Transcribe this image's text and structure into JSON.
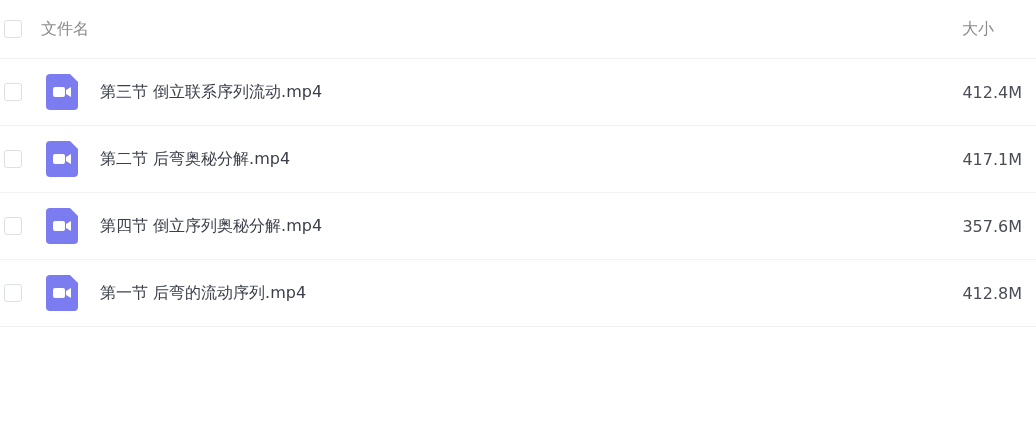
{
  "header": {
    "checked": false,
    "columns": [
      "文件名",
      "大小"
    ]
  },
  "rows": [
    {
      "checked": false,
      "kind": "video",
      "name": "第三节 倒立联系序列流动.mp4",
      "size": "412.4M"
    },
    {
      "checked": false,
      "kind": "video",
      "name": "第二节 后弯奥秘分解.mp4",
      "size": "417.1M"
    },
    {
      "checked": false,
      "kind": "video",
      "name": "第四节 倒立序列奥秘分解.mp4",
      "size": "357.6M"
    },
    {
      "checked": false,
      "kind": "video",
      "name": "第一节 后弯的流动序列.mp4",
      "size": "412.8M"
    }
  ]
}
